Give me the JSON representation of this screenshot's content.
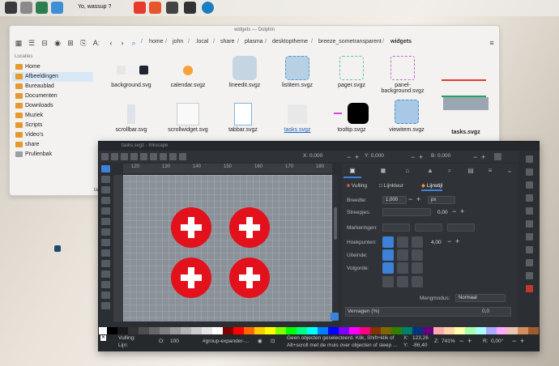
{
  "desktop": {
    "chat_text": "Yo, wassup ?"
  },
  "dolphin": {
    "title": "widgets — Dolphin",
    "breadcrumbs": [
      "home",
      "john",
      ".local",
      "share",
      "plasma",
      "desktoptheme",
      "breeze_sometransparent",
      "widgets"
    ],
    "sidebar_title": "Locaties",
    "places": [
      "Home",
      "Afbeeldingen",
      "Bureaublad",
      "Documenten",
      "Downloads",
      "Muziek",
      "Scripts",
      "Video's",
      "share",
      "Prullenbak"
    ],
    "files_row1": [
      "background.svg",
      "calendar.svgz",
      "lineedit.svgz",
      "listitem.svgz",
      "pager.svgz",
      "panel-background.svgz"
    ],
    "files_row2": [
      "scrollbar.svg",
      "scrollwidget.svg",
      "tabbar.svgz",
      "tasks.svgz",
      "tooltip.svgz",
      "viewitem.svgz",
      "tasks.svgz"
    ],
    "truncated_label": "ta"
  },
  "inkscape": {
    "title": "tasks.svgz - Inkscape",
    "coord_x": "X: 0,000",
    "coord_y": "Y: 0,000",
    "coord_b": "B: 0,000",
    "ruler_ticks": [
      "120",
      "130",
      "140",
      "150",
      "160",
      "170",
      "180"
    ],
    "tabs": {
      "fill": "Vulling",
      "stroke_paint": "Lijnkleur",
      "stroke_style": "Lijnstijl"
    },
    "stroke": {
      "width_label": "Breedte:",
      "width_value": "1,000",
      "width_unit": "px",
      "dashes_label": "Streepjes:",
      "dashes_value": "0,00",
      "markers_label": "Markeringen:",
      "join_label": "Hoekpunten:",
      "join_value": "4,00",
      "cap_label": "Uiteinde:",
      "order_label": "Volgorde:"
    },
    "blend_label": "Mengmodus:",
    "blend_value": "Normaal",
    "blur_label": "Vervagen (%)",
    "blur_value": "0,0",
    "status": {
      "fill_label": "Vulling:",
      "stroke_label": "Lijn:",
      "o_label": "O:",
      "o_value": "100",
      "layer": "#group-expander-...",
      "message_line1": "Geen objecten geselecteerd. Klik, Shift+klik of",
      "message_line2": "Alt+scroll met de muis over objecten of sleep ...",
      "x_label": "X:",
      "x_value": "123,26",
      "y_label": "Y:",
      "y_value": "-86,40",
      "zoom_label": "Z:",
      "zoom_value": "741%",
      "rot_label": "R:",
      "rot_value": "0,00°"
    }
  }
}
